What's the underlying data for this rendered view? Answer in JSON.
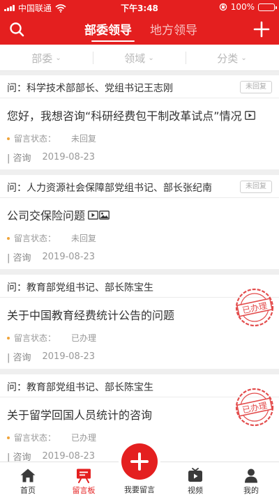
{
  "status_bar": {
    "carrier": "中国联通",
    "time": "下午3:48",
    "battery": "100%",
    "battery_level": 1.0
  },
  "nav": {
    "tabs": [
      {
        "label": "部委领导",
        "active": true
      },
      {
        "label": "地方领导",
        "active": false
      }
    ],
    "left_icon": "search-icon",
    "right_icon": "plus-icon"
  },
  "filters": [
    {
      "label": "部委"
    },
    {
      "label": "领域"
    },
    {
      "label": "分类"
    }
  ],
  "messages": [
    {
      "question": "问：科学技术部部长、党组书记王志刚",
      "title": "您好，我想咨询“科研经费包干制改革试点”情况",
      "media_icons": [
        "video-icon"
      ],
      "status_label": "留言状态：",
      "status_value": "未回复",
      "category": "| 咨询",
      "date": "2019-08-23",
      "badge": "未回复",
      "stamp": ""
    },
    {
      "question": "问：人力资源社会保障部党组书记、部长张纪南",
      "title": "公司交保险问题",
      "media_icons": [
        "video-icon",
        "image-icon"
      ],
      "status_label": "留言状态：",
      "status_value": "未回复",
      "category": "| 咨询",
      "date": "2019-08-23",
      "badge": "未回复",
      "stamp": ""
    },
    {
      "question": "问：教育部党组书记、部长陈宝生",
      "title": "关于中国教育经费统计公告的问题",
      "media_icons": [],
      "status_label": "留言状态：",
      "status_value": "已办理",
      "category": "| 咨询",
      "date": "2019-08-23",
      "badge": "",
      "stamp": "已办理"
    },
    {
      "question": "问：教育部党组书记、部长陈宝生",
      "title": "关于留学回国人员统计的咨询",
      "media_icons": [],
      "status_label": "留言状态：",
      "status_value": "已办理",
      "category": "| 咨询",
      "date": "2019-08-23",
      "badge": "",
      "stamp": "已办理"
    }
  ],
  "tabbar": {
    "items": [
      {
        "label": "首页",
        "icon": "home-icon",
        "active": false
      },
      {
        "label": "留言板",
        "icon": "message-board-icon",
        "active": true
      },
      {
        "label": "我要留言",
        "icon": "plus-icon",
        "active": false
      },
      {
        "label": "视频",
        "icon": "tv-icon",
        "active": false
      },
      {
        "label": "我的",
        "icon": "person-icon",
        "active": false
      }
    ]
  },
  "colors": {
    "brand": "#e41f1f",
    "status_dot": "#f0a43a",
    "muted": "#999999"
  }
}
